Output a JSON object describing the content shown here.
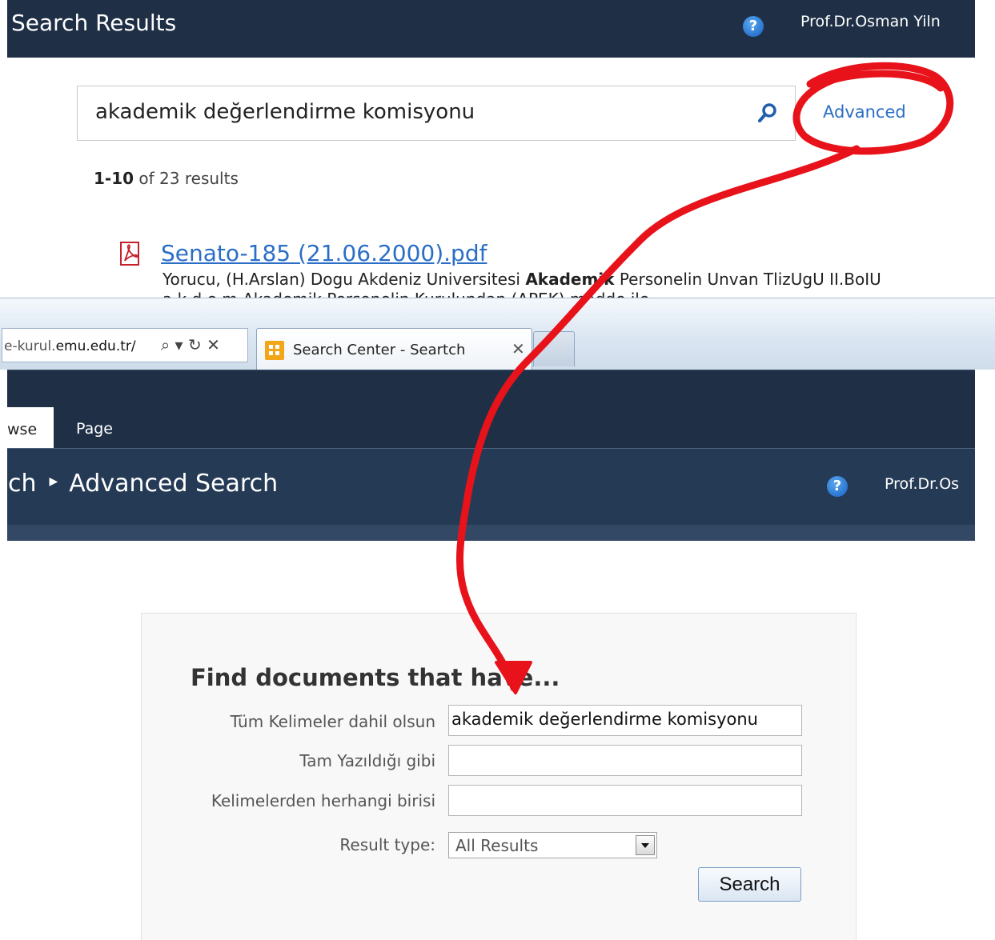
{
  "top": {
    "title": "Search Results",
    "user": "Prof.Dr.Osman Yiln",
    "search_value": "akademik değerlendirme komisyonu",
    "advanced_label": "Advanced",
    "results_range": "1-10",
    "results_suffix": " of 23 results",
    "result": {
      "title": "Senato-185 (21.06.2000).pdf",
      "snippet_prefix": "Yorucu, (H.Arslan) Dogu Akdeniz Universitesi ",
      "snippet_bold": "Akademik",
      "snippet_suffix": " Personelin Unvan TlizUgU II.BoIU",
      "snippet_line2": "a  k  d  e  m  Akademik Personelin Kurulundan (APEK) madde ile"
    }
  },
  "browser": {
    "address_prefix": "e-kurul.",
    "address_domain": "emu.edu.tr/",
    "address_tools": "⌕ ▾ ↻ ✕",
    "tab_title": "Search Center - Seartch",
    "tab_close": "✕"
  },
  "ribbon": {
    "tab_browse": "wse",
    "tab_page": "Page"
  },
  "page": {
    "breadcrumb_first": "ch",
    "breadcrumb_current": "Advanced Search",
    "user": "Prof.Dr.Os"
  },
  "form": {
    "heading": "Find documents that have...",
    "all_words_label": "Tüm Kelimeler dahil olsun",
    "all_words_value": "akademik değerlendirme komisyonu",
    "exact_phrase_label": "Tam Yazıldığı gibi",
    "exact_phrase_value": "",
    "any_words_label": "Kelimelerden herhangi birisi",
    "any_words_value": "",
    "result_type_label": "Result type:",
    "result_type_value": "All Results",
    "search_button": "Search"
  },
  "icons": {
    "help": "help-icon",
    "search": "magnifier-icon",
    "pdf": "pdf-icon"
  },
  "colors": {
    "header_bg": "#1f3046",
    "link": "#2a6ec6",
    "annotation": "#e8121a"
  }
}
